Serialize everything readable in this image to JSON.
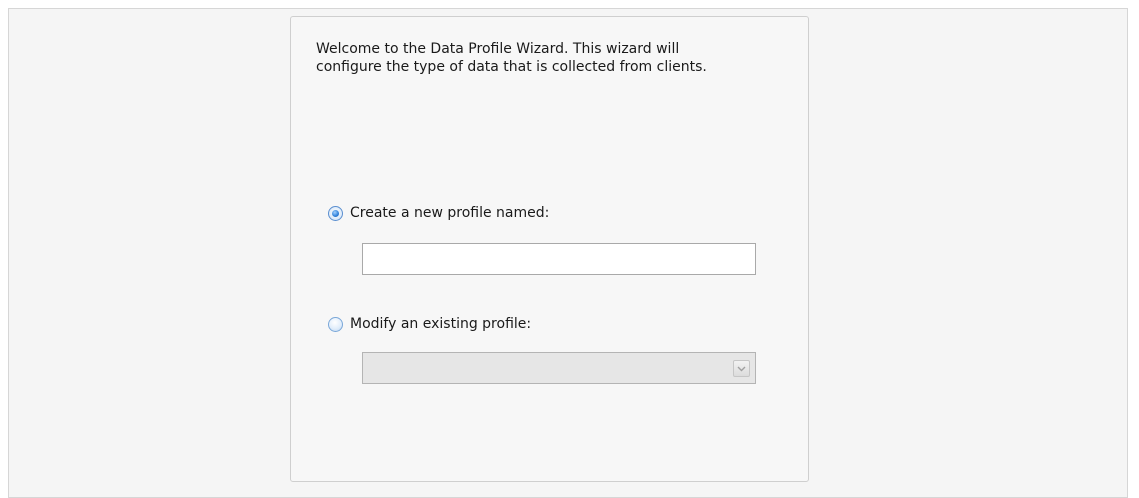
{
  "wizard": {
    "intro_text": "Welcome to the Data Profile Wizard.  This wizard will\nconfigure the type of data that is collected from clients.",
    "options": [
      {
        "label": "Create a new profile named:",
        "selected": true
      },
      {
        "label": "Modify an existing profile:",
        "selected": false
      }
    ],
    "new_profile_name": {
      "value": "",
      "placeholder": ""
    },
    "existing_profile_select": {
      "selected_value": "",
      "disabled": true
    }
  },
  "icons": {
    "radio_selected": "radio-selected-icon",
    "radio_unselected": "radio-unselected-icon",
    "dropdown_arrow": "chevron-down-icon"
  },
  "colors": {
    "page_background": "#f5f5f5",
    "panel_background": "#f7f7f7",
    "radio_accent": "#2f7fd8",
    "disabled_select": "#e6e6e6"
  }
}
